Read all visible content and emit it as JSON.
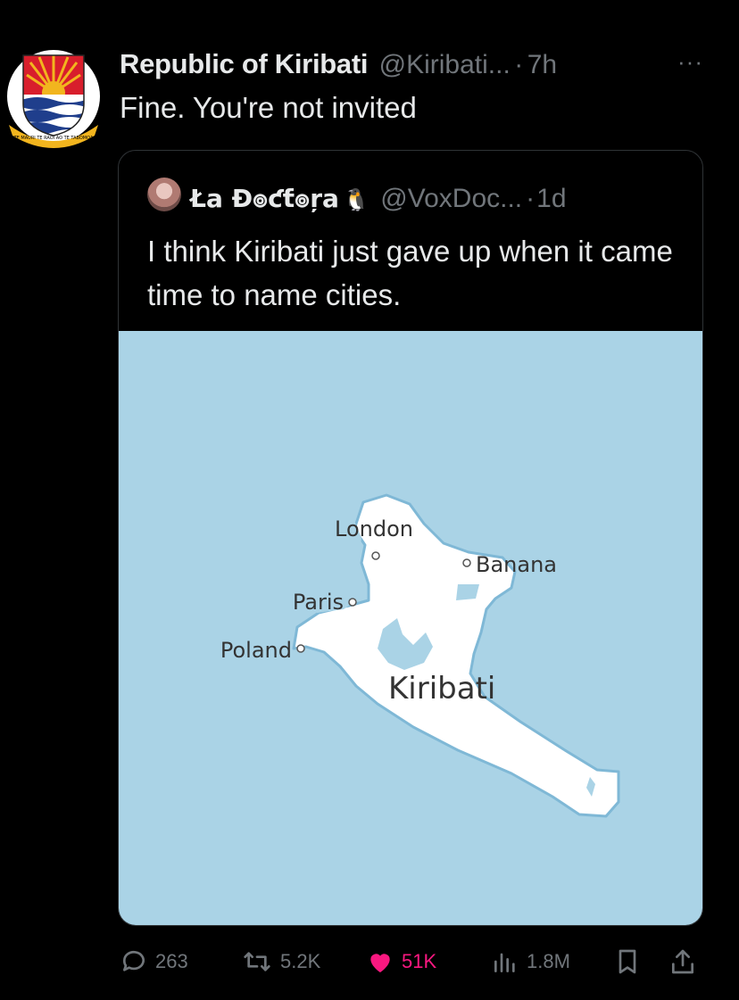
{
  "tweet": {
    "author_name": "Republic of Kiribati",
    "author_handle": "@Kiribati...",
    "separator": "·",
    "time": "7h",
    "more": "···",
    "text": "Fine. You're not invited",
    "avatar_icon": "kiribati-seal-icon",
    "seal_motto": "TE MAURI TE RAOI AO TE TABOMOA"
  },
  "quote": {
    "author_name": "Łа Ɖ๏ƈƭ๏ŗа",
    "author_emoji": "🐧",
    "author_handle": "@VoxDoc...",
    "separator": "·",
    "time": "1d",
    "text": "I think Kiribati just gave up when it came time to name cities.",
    "map": {
      "country_label": "Kiribati",
      "cities": [
        "London",
        "Banana",
        "Paris",
        "Poland"
      ],
      "water_color": "#aad3e6",
      "land_color": "#ffffff"
    }
  },
  "actions": {
    "replies": "263",
    "reposts": "5.2K",
    "likes": "51K",
    "views": "1.8M",
    "accent_like": "#f91880"
  }
}
